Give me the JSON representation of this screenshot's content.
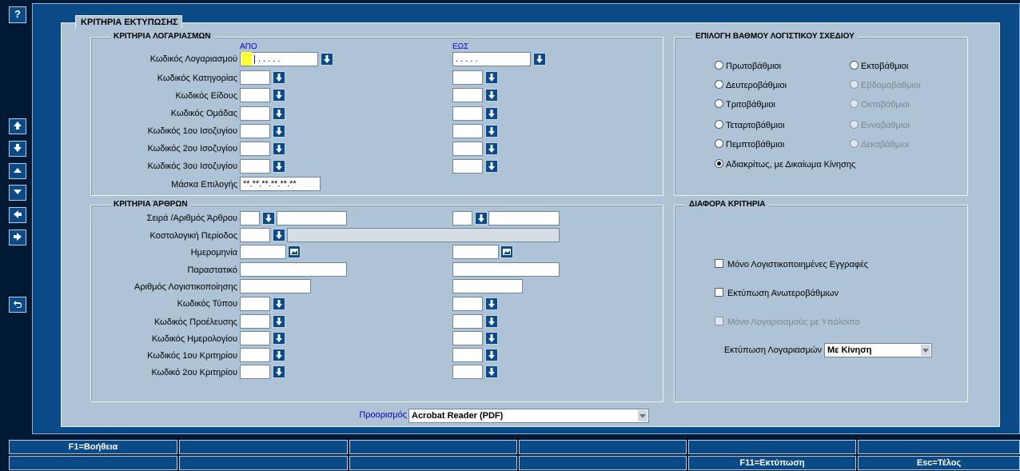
{
  "sidebar": {
    "help_label": "?"
  },
  "form": {
    "tab_label": "ΚΡΙΤΗΡΙΑ ΕΚΤΥΠΩΣΗΣ",
    "accounts": {
      "title": "ΚΡΙΤΗΡΙΑ ΛΟΓΑΡΙΑΣΜΩΝ",
      "from_label": "ΑΠΟ",
      "to_label": "ΕΩΣ",
      "account_code_label": "Κωδικός Λογαριασμού",
      "account_code_from": "|  .  .  .  .  .",
      "account_code_to": ".  .  .  .  .",
      "category_label": "Κωδικός Κατηγορίας",
      "type_label": "Κωδικός Είδους",
      "group_label": "Κωδικός Ομάδας",
      "tb1_label": "Κωδικός 1ου Ισοζυγίου",
      "tb2_label": "Κωδικός 2ου Ισοζυγίου",
      "tb3_label": "Κωδικός 3ου Ισοζυγίου",
      "mask_label": "Μάσκα Επιλογής",
      "mask_value": "**.**.**.**.**.**"
    },
    "levels": {
      "title": "ΕΠΙΛΟΓΗ ΒΑΘΜΟΥ ΛΟΓΙΣΤΙΚΟΥ ΣΧΕΔΙΟΥ",
      "options": [
        "Πρωτοβάθμιοι",
        "Δευτεροβάθμιοι",
        "Τριτοβάθμιοι",
        "Τεταρτοβάθμιοι",
        "Πεμπτοβάθμιοι",
        "Εκτοβάθμιοι",
        "Εβδομοβάθμιοι",
        "Οκταβάθμιοι",
        "Ενναβάθμιοι",
        "Δεκαβάθμιοι",
        "Αδιακρίτως, με Δικαίωμα Κίνησης"
      ],
      "selected": "Αδιακρίτως, με Δικαίωμα Κίνησης"
    },
    "entries": {
      "title": "ΚΡΙΤΗΡΙΑ ΆΡΘΡΩΝ",
      "series_label": "Σειρά /Αριθμός Άρθρου",
      "cost_period_label": "Κοστολογική Περίοδος",
      "date_label": "Ημερομηνία",
      "document_label": "Παραστατικό",
      "posting_no_label": "Αριθμός Λογιστικοποίησης",
      "type_code_label": "Κωδικός Τύπου",
      "origin_code_label": "Κωδικός Προέλευσης",
      "journal_code_label": "Κωδικός Ημερολογίου",
      "crit1_label": "Κωδικός 1ου Κριτηρίου",
      "crit2_label": "Κωδικό 2ου Κριτηρίου"
    },
    "misc": {
      "title": "ΔΙΑΦΟΡΑ ΚΡΙΤΗΡΙΑ",
      "only_posted": "Μόνο Λογιστικοποιημένες Εγγραφές",
      "print_higher": "Εκτύπωση Ανωτεροβάθμιων",
      "only_balance": "Μόνο Λογαριασμούς με Υπόλοιπο",
      "print_accounts_label": "Εκτύπωση Λογαριασμών",
      "print_accounts_value": "Με Κίνηση"
    },
    "destination_label": "Προορισμός",
    "destination_value": "Acrobat Reader (PDF)"
  },
  "fkeys": {
    "row1": [
      "F1=Βοήθεια",
      "",
      "",
      "",
      "",
      ""
    ],
    "row2": [
      "",
      "",
      "",
      "",
      "F11=Εκτύπωση",
      "Esc=Τέλος"
    ]
  },
  "colors": {
    "background": "#001a35",
    "frame": "#0a4a86",
    "panel": "#aec3d6",
    "header_blue": "#0000c0",
    "cursor": "#ffff33"
  }
}
